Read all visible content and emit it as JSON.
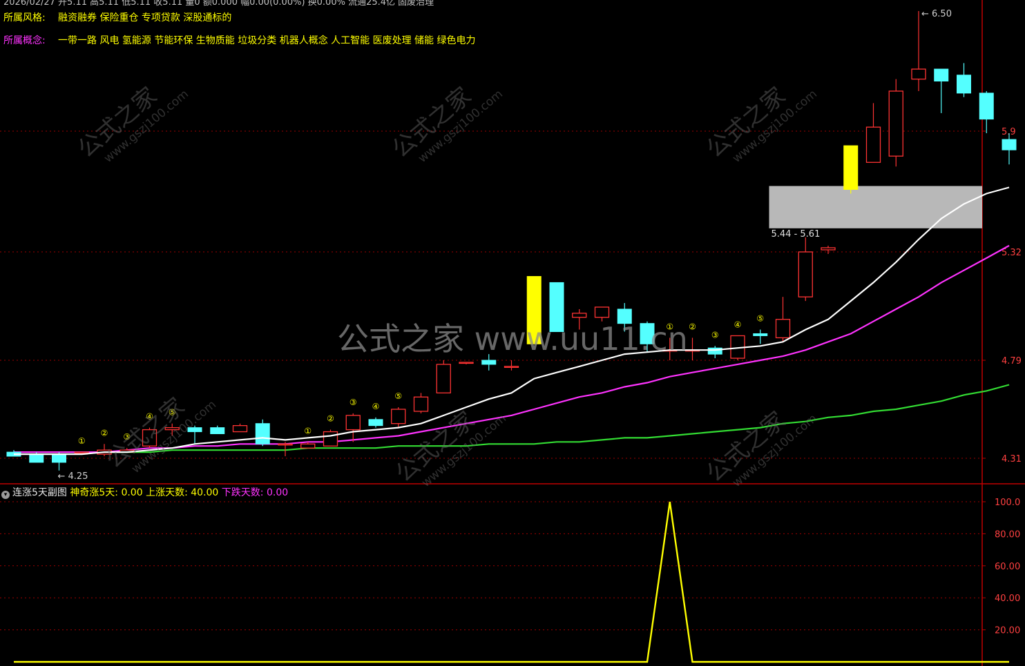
{
  "header": {
    "top_line": "2026/02/27  开5.11 高5.11 低5.11 收5.11 量0 额0.000 幅0.00(0.00%) 换0.00% 流通25.4亿 固废治理",
    "style_label": "所属风格:",
    "style_value": "融资融券 保险重仓 专项贷款 深股通标的",
    "concept_label": "所属概念:",
    "concept_value": "一带一路 风电 氢能源 节能环保 生物质能 垃圾分类 机器人概念 人工智能 医废处理 储能 绿色电力"
  },
  "watermark": {
    "center": "公式之家 www.uu11.cn",
    "diag_big": "公式之家",
    "diag_small": "www.gszj100.com"
  },
  "sub_panel": {
    "title": "连涨5天副图",
    "items": [
      {
        "label": "神奇涨5天:",
        "value": "0.00"
      },
      {
        "label": "上涨天数:",
        "value": "40.00"
      },
      {
        "label": "下跌天数:",
        "value": "0.00"
      }
    ]
  },
  "colors": {
    "up": "#ff3333",
    "down": "#54ffff",
    "highlight": "#ffff00",
    "ma_white": "#ffffff",
    "ma_magenta": "#ff33ff",
    "ma_green": "#33dd33",
    "grid": "#a00000",
    "zone": "#c8c8c8"
  },
  "chart_data": [
    {
      "type": "candlestick",
      "y_axis_ticks": [
        "5.9",
        "5.32",
        "4.79",
        "4.31"
      ],
      "ylim": [
        4.18,
        6.55
      ],
      "candles": [
        {
          "o": 4.34,
          "c": 4.32,
          "h": 4.35,
          "l": 4.32
        },
        {
          "o": 4.33,
          "c": 4.29,
          "h": 4.34,
          "l": 4.29
        },
        {
          "o": 4.33,
          "c": 4.29,
          "h": 4.34,
          "l": 4.25
        },
        {
          "o": 4.34,
          "c": 4.34,
          "h": 4.34,
          "l": 4.34
        },
        {
          "o": 4.33,
          "c": 4.35,
          "h": 4.38,
          "l": 4.32
        },
        {
          "o": 4.34,
          "c": 4.35,
          "h": 4.36,
          "l": 4.34
        },
        {
          "o": 4.37,
          "c": 4.45,
          "h": 4.46,
          "l": 4.36
        },
        {
          "o": 4.45,
          "c": 4.46,
          "h": 4.48,
          "l": 4.42
        },
        {
          "o": 4.46,
          "c": 4.44,
          "h": 4.47,
          "l": 4.38
        },
        {
          "o": 4.46,
          "c": 4.43,
          "h": 4.47,
          "l": 4.43
        },
        {
          "o": 4.44,
          "c": 4.47,
          "h": 4.48,
          "l": 4.44
        },
        {
          "o": 4.48,
          "c": 4.38,
          "h": 4.5,
          "l": 4.37
        },
        {
          "o": 4.38,
          "c": 4.38,
          "h": 4.39,
          "l": 4.32
        },
        {
          "o": 4.36,
          "c": 4.38,
          "h": 4.39,
          "l": 4.36
        },
        {
          "o": 4.37,
          "c": 4.44,
          "h": 4.45,
          "l": 4.37
        },
        {
          "o": 4.45,
          "c": 4.52,
          "h": 4.53,
          "l": 4.39
        },
        {
          "o": 4.5,
          "c": 4.47,
          "h": 4.51,
          "l": 4.46
        },
        {
          "o": 4.48,
          "c": 4.55,
          "h": 4.56,
          "l": 4.46
        },
        {
          "o": 4.54,
          "c": 4.61,
          "h": 4.63,
          "l": 4.53
        },
        {
          "o": 4.63,
          "c": 4.77,
          "h": 4.79,
          "l": 4.63
        },
        {
          "o": 4.78,
          "c": 4.78,
          "h": 4.78,
          "l": 4.77
        },
        {
          "o": 4.79,
          "c": 4.77,
          "h": 4.82,
          "l": 4.74
        },
        {
          "o": 4.76,
          "c": 4.76,
          "h": 4.79,
          "l": 4.74
        },
        {
          "o": 4.87,
          "c": 5.2,
          "h": 5.2,
          "l": 4.87,
          "hl": true
        },
        {
          "o": 5.17,
          "c": 4.93,
          "h": 5.17,
          "l": 4.93
        },
        {
          "o": 5.0,
          "c": 5.02,
          "h": 5.04,
          "l": 4.94
        },
        {
          "o": 5.0,
          "c": 5.05,
          "h": 5.05,
          "l": 4.98
        },
        {
          "o": 5.04,
          "c": 4.97,
          "h": 5.07,
          "l": 4.93
        },
        {
          "o": 4.97,
          "c": 4.87,
          "h": 4.98,
          "l": 4.83
        },
        {
          "o": 4.84,
          "c": 4.84,
          "h": 4.9,
          "l": 4.79
        },
        {
          "o": 4.84,
          "c": 4.84,
          "h": 4.9,
          "l": 4.79
        },
        {
          "o": 4.85,
          "c": 4.82,
          "h": 4.86,
          "l": 4.8
        },
        {
          "o": 4.8,
          "c": 4.91,
          "h": 4.91,
          "l": 4.79
        },
        {
          "o": 4.92,
          "c": 4.91,
          "h": 4.94,
          "l": 4.87
        },
        {
          "o": 4.9,
          "c": 4.99,
          "h": 5.1,
          "l": 4.88
        },
        {
          "o": 5.1,
          "c": 5.32,
          "h": 5.39,
          "l": 5.08
        },
        {
          "o": 5.33,
          "c": 5.34,
          "h": 5.35,
          "l": 5.31
        },
        {
          "o": 5.62,
          "c": 5.83,
          "h": 5.83,
          "l": 5.6,
          "hl": true
        },
        {
          "o": 5.75,
          "c": 5.92,
          "h": 6.04,
          "l": 5.75
        },
        {
          "o": 5.78,
          "c": 6.1,
          "h": 6.16,
          "l": 5.73
        },
        {
          "o": 6.16,
          "c": 6.21,
          "h": 6.5,
          "l": 6.1
        },
        {
          "o": 6.21,
          "c": 6.15,
          "h": 6.21,
          "l": 5.99
        },
        {
          "o": 6.18,
          "c": 6.09,
          "h": 6.24,
          "l": 6.07
        },
        {
          "o": 6.09,
          "c": 5.96,
          "h": 6.1,
          "l": 5.89
        },
        {
          "o": 5.86,
          "c": 5.81,
          "h": 5.89,
          "l": 5.74
        }
      ],
      "ma_white": [
        4.33,
        4.33,
        4.33,
        4.33,
        4.34,
        4.34,
        4.35,
        4.36,
        4.38,
        4.39,
        4.4,
        4.41,
        4.4,
        4.41,
        4.42,
        4.44,
        4.45,
        4.46,
        4.48,
        4.52,
        4.56,
        4.6,
        4.63,
        4.7,
        4.73,
        4.76,
        4.79,
        4.82,
        4.83,
        4.84,
        4.84,
        4.84,
        4.85,
        4.86,
        4.88,
        4.94,
        4.99,
        5.08,
        5.17,
        5.27,
        5.38,
        5.48,
        5.55,
        5.6,
        5.63
      ],
      "ma_magenta": [
        4.34,
        4.34,
        4.34,
        4.34,
        4.34,
        4.35,
        4.36,
        4.36,
        4.37,
        4.37,
        4.38,
        4.38,
        4.38,
        4.39,
        4.39,
        4.4,
        4.41,
        4.42,
        4.44,
        4.46,
        4.48,
        4.5,
        4.52,
        4.55,
        4.58,
        4.61,
        4.63,
        4.66,
        4.68,
        4.71,
        4.73,
        4.75,
        4.77,
        4.79,
        4.81,
        4.84,
        4.88,
        4.92,
        4.98,
        5.04,
        5.1,
        5.17,
        5.23,
        5.29,
        5.35
      ],
      "ma_green": [
        4.34,
        4.34,
        4.34,
        4.34,
        4.34,
        4.34,
        4.34,
        4.35,
        4.35,
        4.35,
        4.35,
        4.35,
        4.35,
        4.36,
        4.36,
        4.36,
        4.36,
        4.37,
        4.37,
        4.37,
        4.37,
        4.38,
        4.38,
        4.38,
        4.39,
        4.39,
        4.4,
        4.41,
        4.41,
        4.42,
        4.43,
        4.44,
        4.45,
        4.46,
        4.48,
        4.49,
        4.51,
        4.52,
        4.54,
        4.55,
        4.57,
        4.59,
        4.62,
        4.64,
        4.67
      ],
      "markers": [
        {
          "i": 3,
          "t": "①"
        },
        {
          "i": 4,
          "t": "②"
        },
        {
          "i": 5,
          "t": "③"
        },
        {
          "i": 6,
          "t": "④"
        },
        {
          "i": 7,
          "t": "⑤"
        },
        {
          "i": 13,
          "t": "①"
        },
        {
          "i": 14,
          "t": "②"
        },
        {
          "i": 15,
          "t": "③"
        },
        {
          "i": 16,
          "t": "④"
        },
        {
          "i": 17,
          "t": "⑤"
        },
        {
          "i": 29,
          "t": "①"
        },
        {
          "i": 30,
          "t": "②"
        },
        {
          "i": 31,
          "t": "③"
        },
        {
          "i": 32,
          "t": "④"
        },
        {
          "i": 33,
          "t": "⑤"
        }
      ],
      "zone": {
        "low": 5.44,
        "high": 5.61,
        "label": "5.44 - 5.61",
        "from_index": 34
      },
      "max_label": "6.50",
      "min_label": "4.25"
    },
    {
      "type": "line",
      "y_axis_ticks": [
        "100.0",
        "80.00",
        "60.00",
        "40.00",
        "20.00"
      ],
      "ylim": [
        0,
        100
      ],
      "series": [
        {
          "name": "神奇涨5天",
          "values": [
            0,
            0,
            0,
            0,
            0,
            0,
            0,
            0,
            0,
            0,
            0,
            0,
            0,
            0,
            0,
            0,
            0,
            0,
            0,
            0,
            0,
            0,
            0,
            0,
            0,
            0,
            0,
            0,
            0,
            100,
            0,
            0,
            0,
            0,
            0,
            0,
            0,
            0,
            0,
            0,
            0,
            0,
            0,
            0,
            0
          ]
        }
      ]
    }
  ]
}
